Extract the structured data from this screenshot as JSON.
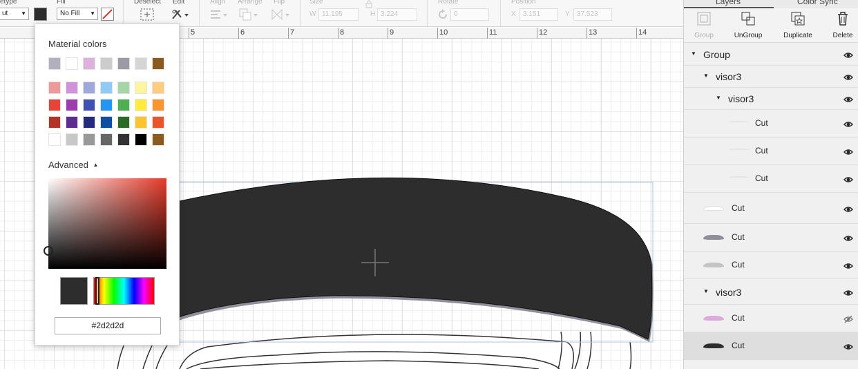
{
  "toolbar": {
    "linetype_label": "etype",
    "linetype_value": "ut",
    "fill_label": "Fill",
    "fill_value": "No Fill",
    "deselect_label": "Deselect",
    "edit_label": "Edit",
    "align_label": "Align",
    "arrange_label": "Arrange",
    "flip_label": "Flip",
    "size_label": "Size",
    "size_w_label": "W",
    "size_w_value": "11.195",
    "size_h_label": "H",
    "size_h_value": "3.224",
    "rotate_label": "Rotate",
    "rotate_value": "0",
    "position_label": "Position",
    "pos_x_label": "X",
    "pos_x_value": "3.151",
    "pos_y_label": "Y",
    "pos_y_value": "37.523"
  },
  "ruler": {
    "numbers": [
      "5",
      "6",
      "7",
      "8",
      "9",
      "10",
      "11",
      "12",
      "13",
      "14"
    ]
  },
  "color_popover": {
    "material_heading": "Material colors",
    "advanced_label": "Advanced",
    "hex_value": "#2d2d2d",
    "selected_color": "#2d2d2d",
    "swatch_rows": [
      [
        "#b1b1be",
        "#ffffff",
        "#deb1dc",
        "#cccccc",
        "#9b9ba5",
        "#d5d5d5",
        "#8b5a1e"
      ],
      [
        "#ef9a9a",
        "#ce93d8",
        "#9fa8da",
        "#90caf9",
        "#a5d6a7",
        "#fff59d",
        "#ffcc80"
      ],
      [
        "#e84337",
        "#9c3cae",
        "#3f51b5",
        "#2196f3",
        "#4caf50",
        "#ffeb3b",
        "#f8952d"
      ],
      [
        "#b53324",
        "#5e2b93",
        "#242a80",
        "#0c4fa3",
        "#2a6b24",
        "#fdc42e",
        "#ec5528"
      ],
      [
        "#ffffff",
        "#c8c8c8",
        "#999999",
        "#666666",
        "#333333",
        "#000000",
        "#8b5a1e"
      ]
    ]
  },
  "panel": {
    "tabs": [
      "Layers",
      "Color Sync"
    ],
    "actions": [
      {
        "label": "Group",
        "icon": "group-icon",
        "enabled": false
      },
      {
        "label": "UnGroup",
        "icon": "ungroup-icon",
        "enabled": true
      },
      {
        "label": "Duplicate",
        "icon": "duplicate-icon",
        "enabled": true
      },
      {
        "label": "Delete",
        "icon": "trash-icon",
        "enabled": true
      }
    ],
    "layers": [
      {
        "name": "Group",
        "level": 0,
        "expandable": true,
        "thumb": null
      },
      {
        "name": "visor3",
        "level": 1,
        "expandable": true,
        "thumb": null
      },
      {
        "name": "visor3",
        "level": 2,
        "expandable": true,
        "thumb": null
      },
      {
        "name": "Cut",
        "level": 3,
        "expandable": false,
        "thumb": "#e4e4e4"
      },
      {
        "name": "Cut",
        "level": 3,
        "expandable": false,
        "thumb": "#e4e4e4"
      },
      {
        "name": "Cut",
        "level": 3,
        "expandable": false,
        "thumb": "#e4e4e4"
      },
      {
        "name": "Cut",
        "level": 1,
        "expandable": false,
        "thumb": "#ffffff"
      },
      {
        "name": "Cut",
        "level": 1,
        "expandable": false,
        "thumb": "#8f8f99"
      },
      {
        "name": "Cut",
        "level": 1,
        "expandable": false,
        "thumb": "#c4c4c4"
      },
      {
        "name": "visor3",
        "level": 1,
        "expandable": true,
        "thumb": null
      },
      {
        "name": "Cut",
        "level": 1,
        "expandable": false,
        "thumb": "#deaadc",
        "hidden": true
      },
      {
        "name": "Cut",
        "level": 1,
        "expandable": false,
        "thumb": "#2d2d2d",
        "selected": true
      }
    ]
  }
}
